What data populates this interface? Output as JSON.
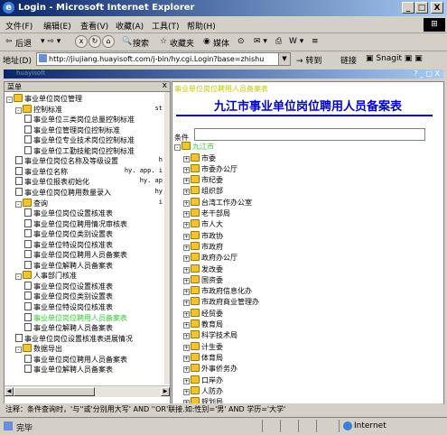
{
  "window": {
    "title": "Login - Microsoft Internet Explorer",
    "min": "_",
    "max": "□",
    "close": "X"
  },
  "menu": [
    "文件(F)",
    "编辑(E)",
    "查看(V)",
    "收藏(A)",
    "工具(T)",
    "帮助(H)"
  ],
  "toolbar": {
    "back": "后退",
    "search": "搜索",
    "favorites": "收藏夹",
    "media": "媒体"
  },
  "address": {
    "label": "地址(D)",
    "url": "http://jiujiang.huayisoft.com/j-bin/hy.cgi.Login?base=zhishu",
    "go": "转到",
    "links": "链接",
    "snagit": "Snagit"
  },
  "inner": {
    "title": "huayisoft",
    "controls": "? _ □ X"
  },
  "left": {
    "header": "菜单",
    "close": "x",
    "items": [
      {
        "label": "事业单位岗位管理",
        "type": "folder",
        "depth": 0,
        "pm": "-"
      },
      {
        "label": "控制标准",
        "type": "folder",
        "depth": 1,
        "pm": "-",
        "suffix": "st"
      },
      {
        "label": "事业单位三类岗位总量控制标准",
        "type": "page",
        "depth": 2
      },
      {
        "label": "事业单位管理岗位控制标准",
        "type": "page",
        "depth": 2
      },
      {
        "label": "事业单位专业技术岗位控制标准",
        "type": "page",
        "depth": 2
      },
      {
        "label": "事业单位工勤技能岗位控制标准",
        "type": "page",
        "depth": 2
      },
      {
        "label": "事业单位岗位名称及等级设置",
        "type": "page",
        "depth": 1,
        "suffix": "h"
      },
      {
        "label": "事业单位名称",
        "type": "page",
        "depth": 1,
        "suffix": "hy. app. i"
      },
      {
        "label": "事业单位报表初始化",
        "type": "page",
        "depth": 1,
        "suffix": "hy. ap"
      },
      {
        "label": "事业单位岗位聘用数量录入",
        "type": "page",
        "depth": 1,
        "suffix": "hy"
      },
      {
        "label": "查询",
        "type": "folder",
        "depth": 1,
        "pm": "-",
        "suffix": "i"
      },
      {
        "label": "事业单位岗位设置核准表",
        "type": "page",
        "depth": 2
      },
      {
        "label": "事业单位岗位聘用情况审核表",
        "type": "page",
        "depth": 2
      },
      {
        "label": "事业单位岗位类别设置表",
        "type": "page",
        "depth": 2
      },
      {
        "label": "事业单位特设岗位核准表",
        "type": "page",
        "depth": 2
      },
      {
        "label": "事业单位岗位聘用人员备案表",
        "type": "page",
        "depth": 2
      },
      {
        "label": "事业单位解聘人员备案表",
        "type": "page",
        "depth": 2
      },
      {
        "label": "人事部门核准",
        "type": "folder",
        "depth": 1,
        "pm": "-"
      },
      {
        "label": "事业单位岗位设置核准表",
        "type": "page",
        "depth": 2
      },
      {
        "label": "事业单位岗位类别设置表",
        "type": "page",
        "depth": 2
      },
      {
        "label": "事业单位特设岗位核准表",
        "type": "page",
        "depth": 2
      },
      {
        "label": "事业单位岗位聘用人员备案表",
        "type": "page",
        "depth": 2,
        "selected": true
      },
      {
        "label": "事业单位解聘人员备案表",
        "type": "page",
        "depth": 2
      },
      {
        "label": "事业单位岗位设置核准表进展情况",
        "type": "page",
        "depth": 1
      },
      {
        "label": "数据导出",
        "type": "folder",
        "depth": 1,
        "pm": "-"
      },
      {
        "label": "事业单位岗位聘用人员备案表",
        "type": "page",
        "depth": 2
      },
      {
        "label": "事业单位解聘人员备案表",
        "type": "page",
        "depth": 2
      }
    ]
  },
  "right": {
    "top_label": "事业单位岗位聘用人员备案表",
    "title": "九江市事业单位岗位聘用人员备案表",
    "condition_label": "条件",
    "root": "九江市",
    "units": [
      "市委",
      "市委办公厅",
      "市纪委",
      "组织部",
      "台湾工作办公室",
      "老干部局",
      "市人大",
      "市政协",
      "市政府",
      "政府办公厅",
      "发改委",
      "国资委",
      "市政府信息化办",
      "市政府商业管理办",
      "经贸委",
      "教育局",
      "科学技术局",
      "计生委",
      "体育局",
      "外事侨务办",
      "口岸办",
      "人防办",
      "规划局"
    ]
  },
  "note": "注释：条件查询时，'与''或'分别用大写' AND ''OR'联接.如:性别='男' AND 学历='大学'",
  "status": {
    "done": "完毕",
    "zone": "Internet"
  }
}
